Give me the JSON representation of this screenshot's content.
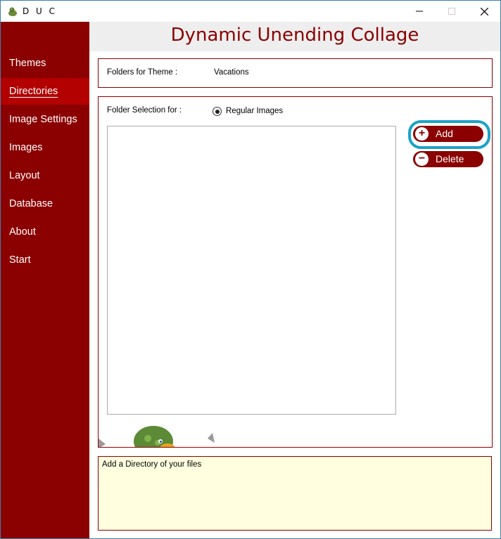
{
  "window": {
    "title": "D U C"
  },
  "header": {
    "title": "Dynamic Unending Collage"
  },
  "sidebar": {
    "items": [
      {
        "label": "Themes",
        "active": false
      },
      {
        "label": "Directories",
        "active": true
      },
      {
        "label": "Image Settings",
        "active": false
      },
      {
        "label": "Images",
        "active": false
      },
      {
        "label": "Layout",
        "active": false
      },
      {
        "label": "Database",
        "active": false
      },
      {
        "label": "About",
        "active": false
      },
      {
        "label": "Start",
        "active": false
      }
    ]
  },
  "theme_panel": {
    "label": "Folders for Theme :",
    "value": "Vacations"
  },
  "folder_panel": {
    "label": "Folder Selection for :",
    "radio_label": "Regular Images",
    "radio_selected": true,
    "folders": []
  },
  "buttons": {
    "add_label": "Add",
    "delete_label": "Delete"
  },
  "help": {
    "text": "Add a Directory of your files"
  },
  "colors": {
    "sidebar": "#8b0000",
    "sidebar_active": "#b30000",
    "accent": "#8b0000",
    "highlight": "#1ba3c6",
    "help_background": "#ffffe0"
  },
  "icons": {
    "app": "duck-icon",
    "minimize": "minimize-icon",
    "maximize": "maximize-icon",
    "close": "close-icon",
    "add": "plus-icon",
    "delete": "minus-icon"
  }
}
